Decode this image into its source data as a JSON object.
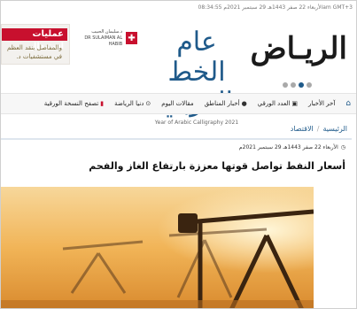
{
  "header": {
    "topline": "الأربعاء 22 صفر 1443هـ 29 سبتمبر 2021م 08:34:55am GMT+3",
    "logo_text": "الريـاض",
    "calligraphy_title": "عام الخط العربي",
    "calligraphy_caption": "Year of Arabic Calligraphy 2021",
    "sponsor_name_ar": "د.سليمان الحبيب",
    "sponsor_name_en": "DR SULAIMAN AL HABIB"
  },
  "ad": {
    "headline": "عمليات استبدال",
    "line1": "والمفاصل بنقد العظم",
    "line2": "في مستشفيات د."
  },
  "carousel": {
    "count": 4,
    "active_index": 3
  },
  "nav": {
    "items": [
      {
        "label": "آخر الأخبار",
        "icon": "home"
      },
      {
        "label": "العدد الورقي",
        "icon": "newspaper"
      },
      {
        "label": "أخبار المناطق",
        "icon": "map-pin"
      },
      {
        "label": "مقالات اليوم",
        "icon": "none"
      },
      {
        "label": "دنيا الرياضة",
        "icon": "soccer-ball"
      },
      {
        "label": "تصفح النسخة الورقية",
        "icon": "pdf"
      }
    ]
  },
  "breadcrumb": {
    "home": "الرئيسية",
    "section": "الاقتصاد",
    "sep": "/"
  },
  "article": {
    "date": "الأربعاء 22 صفر 1443هـ 29 سبتمبر 2021م",
    "title": "أسعار النفط تواصل قوتها معززة بارتفاع الغاز والفحم"
  },
  "colors": {
    "brand": "#1f5a8a",
    "accent_red": "#c8102e",
    "nav_bg": "#f7f7f7"
  }
}
